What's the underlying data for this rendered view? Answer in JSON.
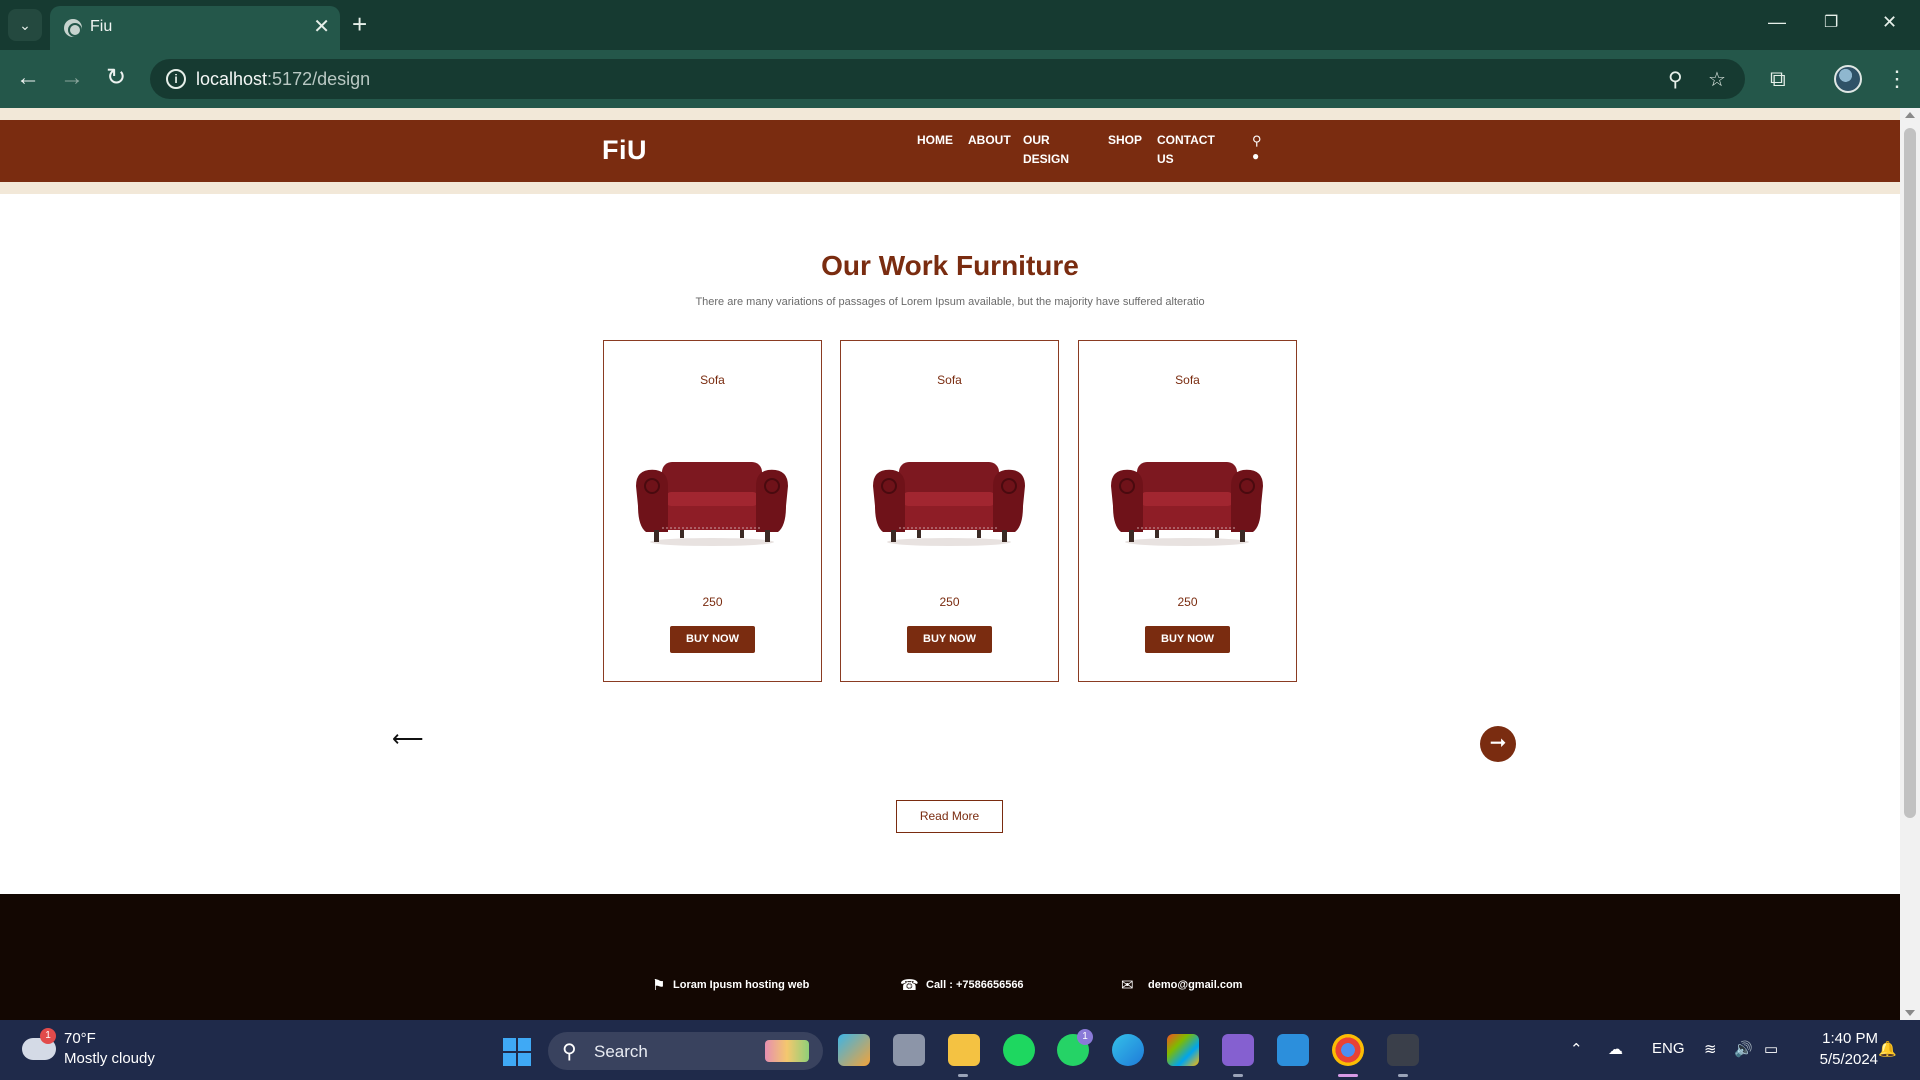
{
  "browser": {
    "tab_title": "Fiu",
    "close_glyph": "✕",
    "new_tab_glyph": "+",
    "url_host": "localhost",
    "url_path": ":5172/design",
    "window_controls": {
      "minimize": "—",
      "restore": "❐",
      "close": "✕"
    }
  },
  "header": {
    "logo": "FiU",
    "nav": [
      {
        "label": "HOME"
      },
      {
        "label": "ABOUT"
      },
      {
        "label": "OUR\nDESIGN"
      },
      {
        "label": "SHOP"
      },
      {
        "label": "CONTACT\nUS"
      }
    ]
  },
  "section": {
    "title": "Our Work Furniture",
    "subtitle": "There are many variations of passages of Lorem Ipsum available, but the majority have suffered alteratio"
  },
  "products": [
    {
      "name": "Sofa",
      "price": "250",
      "button": "BUY NOW"
    },
    {
      "name": "Sofa",
      "price": "250",
      "button": "BUY NOW"
    },
    {
      "name": "Sofa",
      "price": "250",
      "button": "BUY NOW"
    }
  ],
  "carousel": {
    "prev": "⟵",
    "next": "➞"
  },
  "read_more": "Read More",
  "footer": {
    "location": "Loram Ipusm hosting web",
    "phone": "Call : +7586656566",
    "email": "demo@gmail.com"
  },
  "taskbar": {
    "weather_temp": "70°F",
    "weather_desc": "Mostly cloudy",
    "weather_badge": "1",
    "search_label": "Search",
    "whatsapp_badge": "1",
    "language": "ENG",
    "time": "1:40 PM",
    "date": "5/5/2024"
  },
  "colors": {
    "brand": "#7a2c10",
    "header_strip": "#f2e8d8",
    "footer_bg": "#130702",
    "chrome_dark": "#163a31",
    "chrome_light": "#24574a"
  }
}
